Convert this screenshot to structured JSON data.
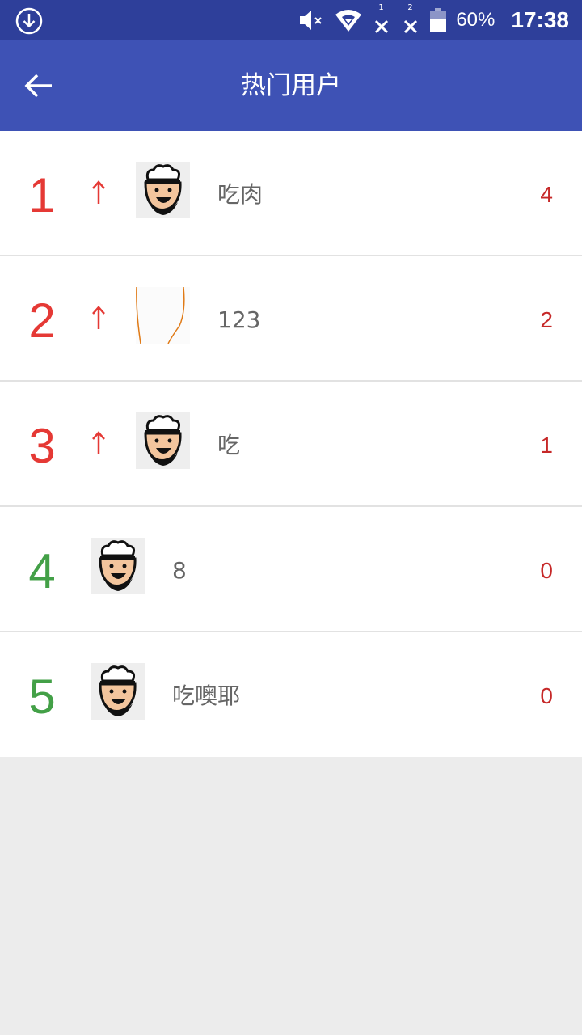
{
  "status_bar": {
    "battery": "60%",
    "time": "17:38",
    "sim1": "1",
    "sim2": "2"
  },
  "app_bar": {
    "title": "热门用户"
  },
  "rows": [
    {
      "rank": "1",
      "trend": "up",
      "avatar": "chef-avatar",
      "name": "吃肉",
      "score": "4"
    },
    {
      "rank": "2",
      "trend": "up",
      "avatar": "sketch-avatar",
      "name": "123",
      "score": "2"
    },
    {
      "rank": "3",
      "trend": "up",
      "avatar": "chef-avatar",
      "name": "吃",
      "score": "1"
    },
    {
      "rank": "4",
      "trend": "none",
      "avatar": "chef-avatar",
      "name": "8",
      "score": "0"
    },
    {
      "rank": "5",
      "trend": "none",
      "avatar": "chef-avatar",
      "name": "吃噢耶",
      "score": "0"
    }
  ],
  "colors": {
    "status_bar": "#2e3f9a",
    "app_bar": "#3e52b5",
    "rank_top": "#e53935",
    "rank_other": "#43a047",
    "score": "#c62828",
    "background": "#ececec"
  }
}
